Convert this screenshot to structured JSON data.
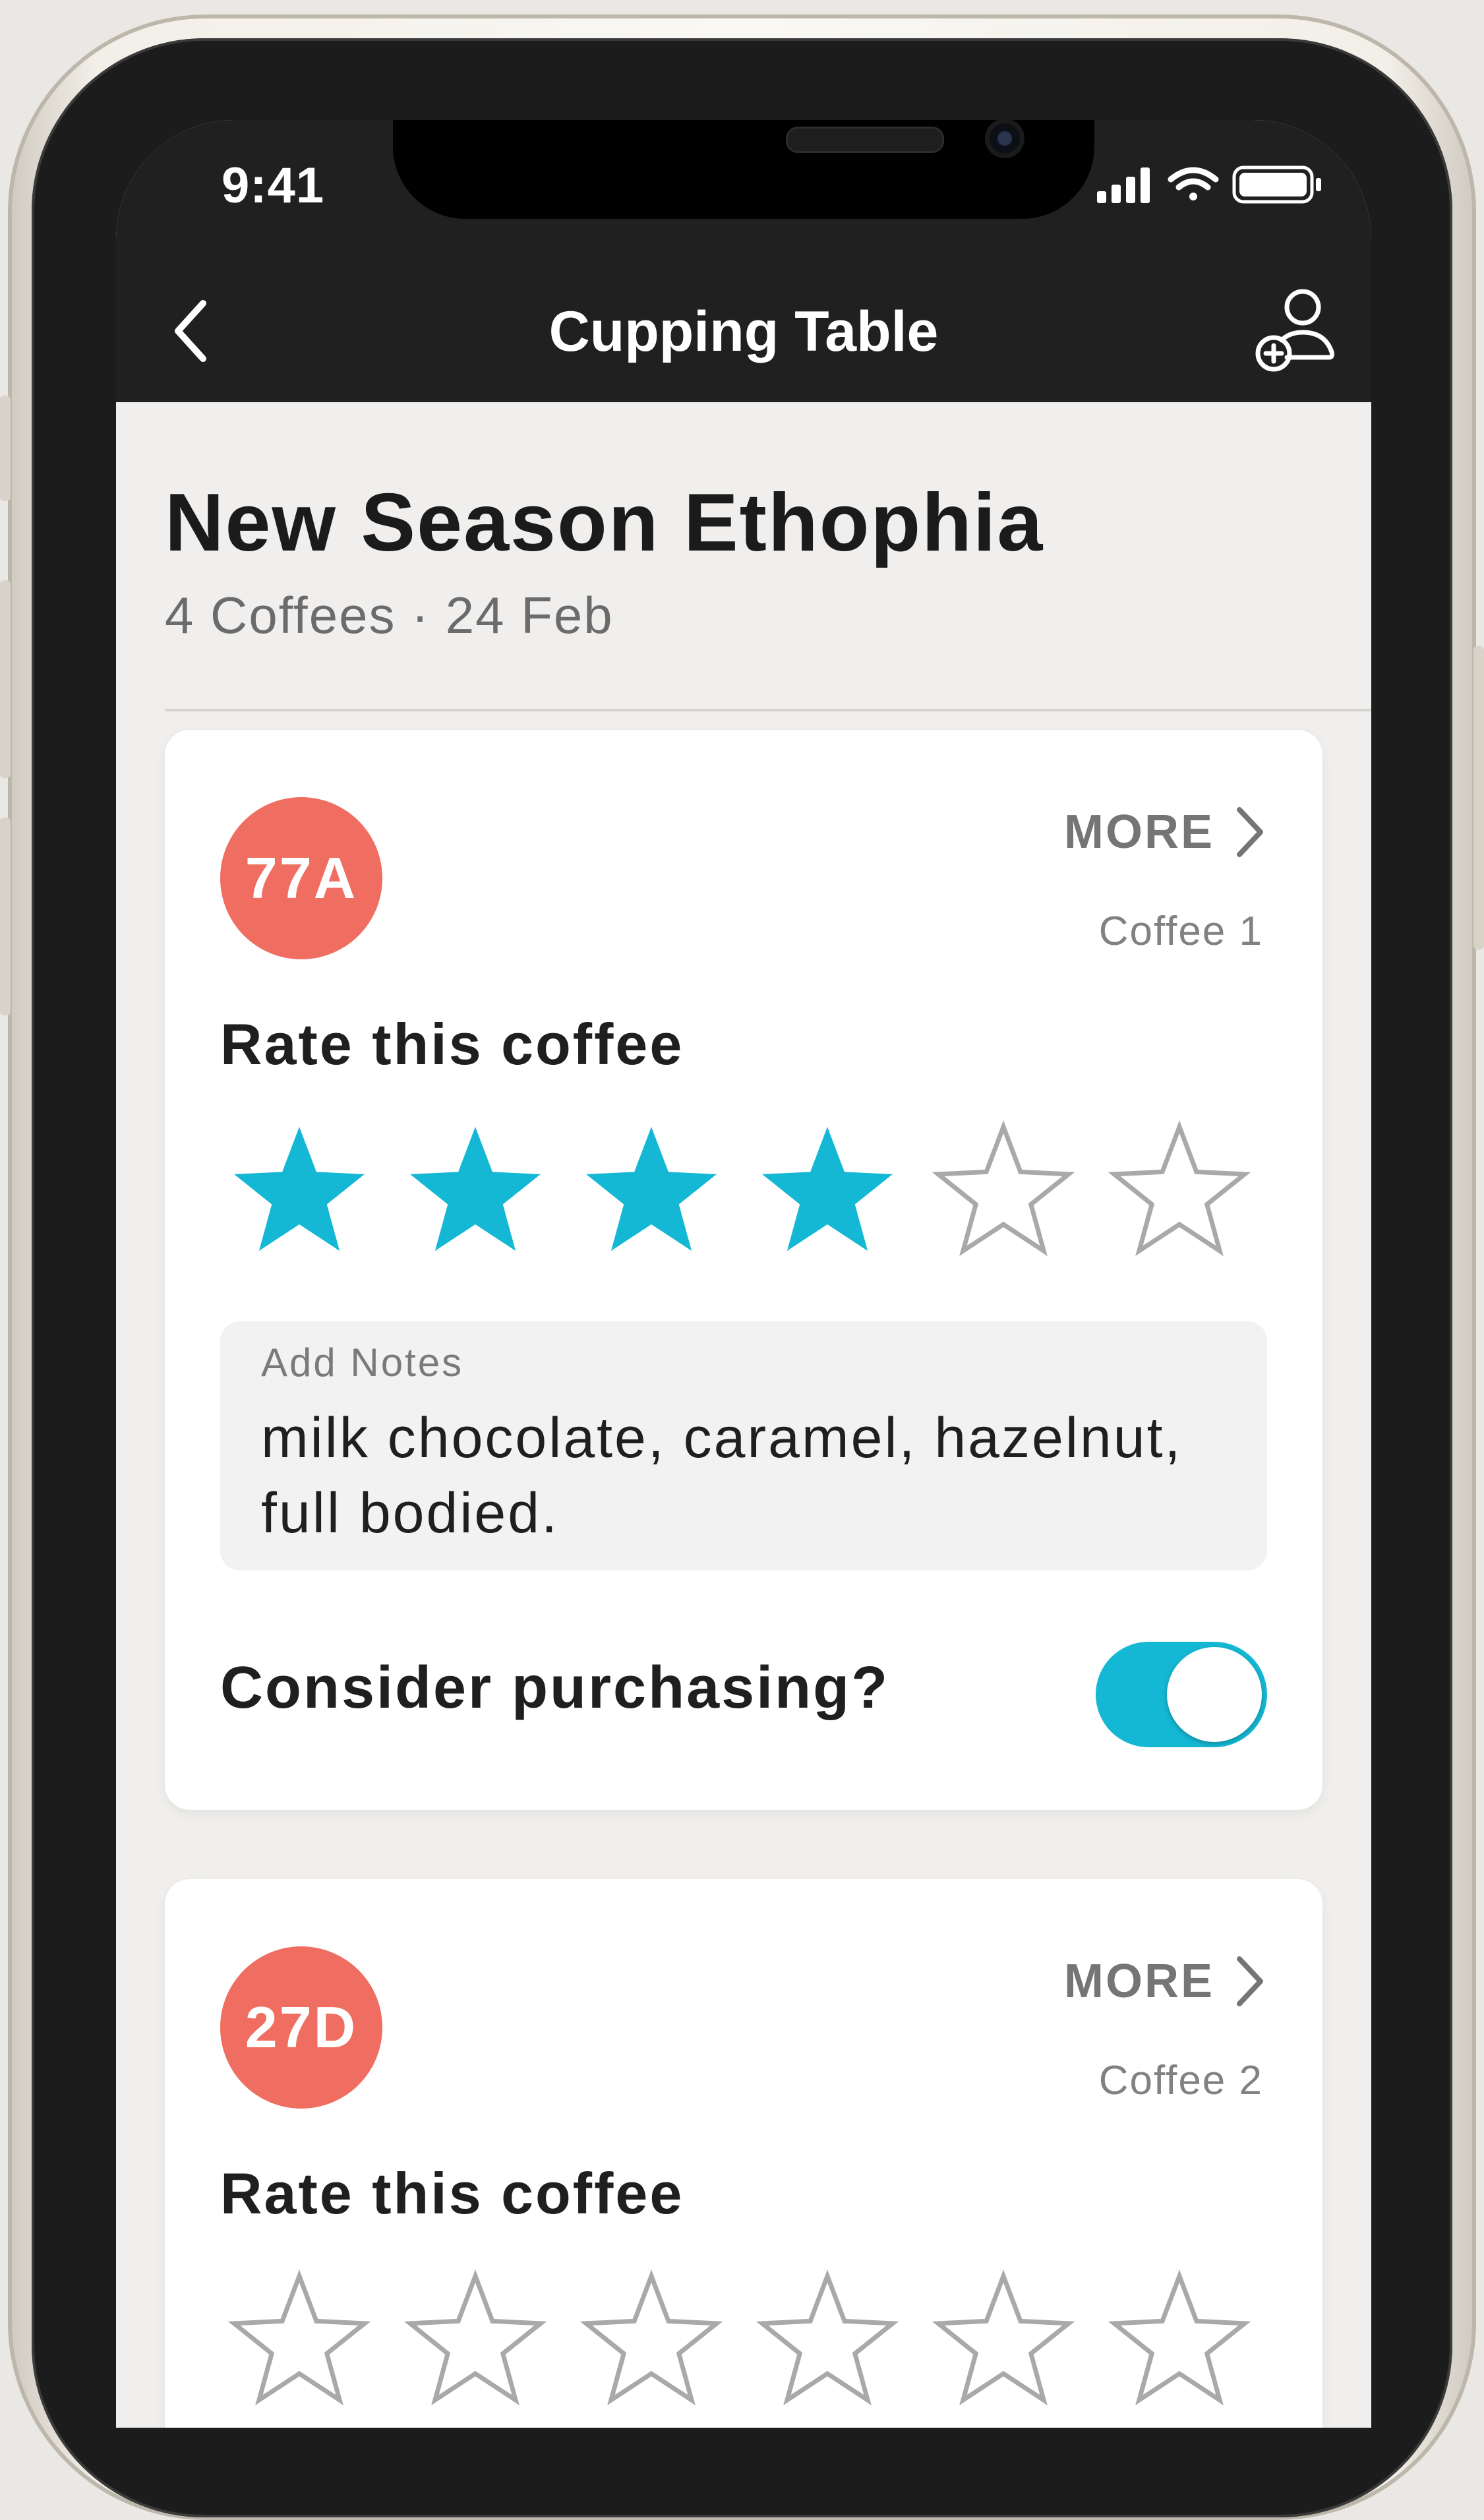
{
  "status_bar": {
    "time": "9:41"
  },
  "nav": {
    "title": "Cupping Table",
    "back_icon": "chevron-left-icon",
    "add_user_icon": "add-user-icon"
  },
  "header": {
    "title": "New Season Ethophia",
    "subtitle": "4 Coffees · 24 Feb"
  },
  "colors": {
    "accent": "#15b8d4",
    "badge": "#ef6e61",
    "nav_bg": "#202020"
  },
  "cards": [
    {
      "code": "77A",
      "more_label": "MORE",
      "coffee_label": "Coffee 1",
      "rate_label": "Rate this coffee",
      "rating": 4,
      "max_rating": 6,
      "notes_label": "Add Notes",
      "notes_text": "milk chocolate, caramel, hazelnut, full bodied.",
      "purchase_label": "Consider purchasing?",
      "consider_purchasing": true
    },
    {
      "code": "27D",
      "more_label": "MORE",
      "coffee_label": "Coffee 2",
      "rate_label": "Rate this coffee",
      "rating": 0,
      "max_rating": 6
    }
  ]
}
